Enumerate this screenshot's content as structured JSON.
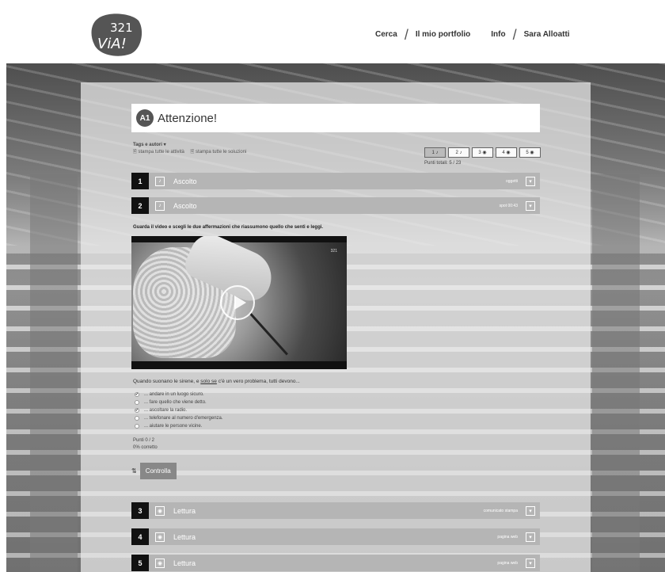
{
  "header": {
    "logo_text": "321 ViA!",
    "nav": [
      "Cerca",
      "Il mio portfolio",
      "Info",
      "Sara Alloatti"
    ]
  },
  "activity": {
    "badge": "A1",
    "title": "Attenzione!",
    "tags_label": "Tags e autori ▾",
    "print_all": "stampa tutte le attività",
    "print_solutions": "stampa tutte le soluzioni",
    "steps": [
      "1 ♪",
      "2 ♪",
      "3 ◉",
      "4 ◉",
      "5 ◉"
    ],
    "points_total": "Punti totali:  5 / 23"
  },
  "sections": [
    {
      "num": "1",
      "icon": "audio-icon",
      "icon_glyph": "♪",
      "label": "Ascolto",
      "tag": "oggetti"
    },
    {
      "num": "2",
      "icon": "audio-icon",
      "icon_glyph": "♪",
      "label": "Ascolto",
      "tag": "spot 00:43"
    },
    {
      "num": "3",
      "icon": "eye-icon",
      "icon_glyph": "◉",
      "label": "Lettura",
      "tag": "comunicato stampa"
    },
    {
      "num": "4",
      "icon": "eye-icon",
      "icon_glyph": "◉",
      "label": "Lettura",
      "tag": "pagina web"
    },
    {
      "num": "5",
      "icon": "eye-icon",
      "icon_glyph": "◉",
      "label": "Lettura",
      "tag": "pagina web"
    }
  ],
  "exercise": {
    "instruction": "Guarda il video e scegli le due affermazioni che riassumono quello che senti e leggi.",
    "video_watermark": "321",
    "question_start": "Quando suonano le sirene, e ",
    "question_u": "solo se",
    "question_end": " c'è un vero problema, tutti devono...",
    "options": [
      {
        "text": "... andare in un luogo sicuro.",
        "checked": true
      },
      {
        "text": "... fare quello che viene detto.",
        "checked": false
      },
      {
        "text": "... ascoltare la radio.",
        "checked": true
      },
      {
        "text": "... telefonare al numero d'emergenza.",
        "checked": false
      },
      {
        "text": "... aiutare le persone vicine.",
        "checked": false
      }
    ],
    "points": "Punti 0 / 2",
    "correct": "0% corretto",
    "check_button": "Controlla"
  }
}
